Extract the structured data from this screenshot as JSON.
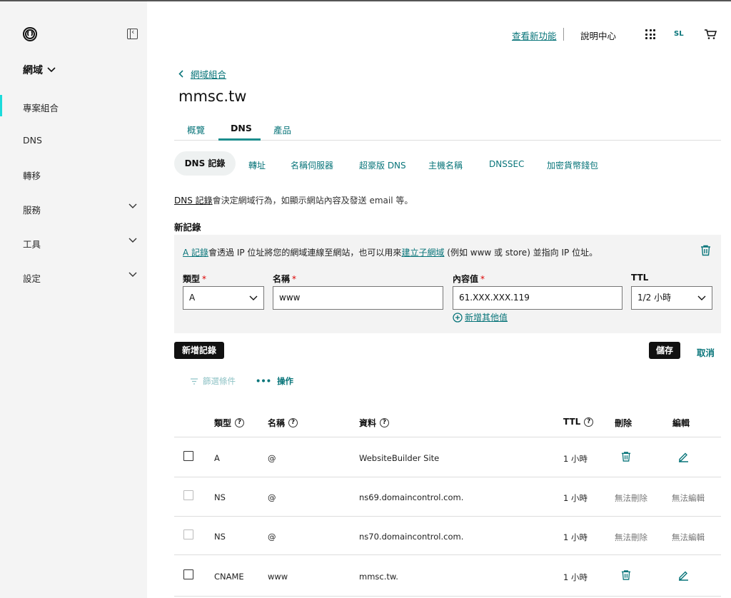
{
  "sidebar": {
    "domain_menu": "網域",
    "items": [
      {
        "label": "專案組合",
        "active": true,
        "has_chevron": false
      },
      {
        "label": "DNS",
        "active": false,
        "has_chevron": false
      },
      {
        "label": "轉移",
        "active": false,
        "has_chevron": false
      },
      {
        "label": "服務",
        "active": false,
        "has_chevron": true
      },
      {
        "label": "工具",
        "active": false,
        "has_chevron": true
      },
      {
        "label": "設定",
        "active": false,
        "has_chevron": true
      }
    ]
  },
  "topbar": {
    "whats_new": "查看新功能",
    "help": "說明中心",
    "avatar": "SL"
  },
  "breadcrumb": {
    "label": "網域組合"
  },
  "page_title": "mmsc.tw",
  "tabs": [
    "概覽",
    "DNS",
    "產品"
  ],
  "subtabs": [
    "DNS 記錄",
    "轉址",
    "名稱伺服器",
    "超豪版 DNS",
    "主機名稱",
    "DNSSEC",
    "加密貨幣錢包"
  ],
  "description": {
    "link": "DNS 記錄",
    "text": "會決定網域行為，如顯示網站內容及發送 email 等。"
  },
  "new_record": {
    "title": "新記錄",
    "info_link1": "A 記錄",
    "info_text1": "會透過 IP 位址將您的網域連線至網站，也可以用來",
    "info_link2": "建立子網域",
    "info_text2": " (例如 www 或 store) 並指向 IP 位址。",
    "fields": {
      "type_label": "類型",
      "type_value": "A",
      "name_label": "名稱",
      "name_value": "www",
      "value_label": "內容值",
      "value_value": "61.XXX.XXX.119",
      "ttl_label": "TTL",
      "ttl_value": "1/2 小時"
    },
    "add_value": "新增其他值"
  },
  "buttons": {
    "add_record": "新增記錄",
    "save": "儲存",
    "cancel": "取消"
  },
  "toolbar": {
    "filter": "篩選條件",
    "actions": "操作"
  },
  "table": {
    "headers": {
      "type": "類型",
      "name": "名稱",
      "data": "資料",
      "ttl": "TTL",
      "delete": "刪除",
      "edit": "編輯"
    },
    "rows": [
      {
        "type": "A",
        "name": "@",
        "data": "WebsiteBuilder Site",
        "ttl": "1 小時",
        "delete": "",
        "edit": "",
        "editable": true
      },
      {
        "type": "NS",
        "name": "@",
        "data": "ns69.domaincontrol.com.",
        "ttl": "1 小時",
        "delete": "無法刪除",
        "edit": "無法編輯",
        "editable": false
      },
      {
        "type": "NS",
        "name": "@",
        "data": "ns70.domaincontrol.com.",
        "ttl": "1 小時",
        "delete": "無法刪除",
        "edit": "無法編輯",
        "editable": false
      },
      {
        "type": "CNAME",
        "name": "www",
        "data": "mmsc.tw.",
        "ttl": "1 小時",
        "delete": "",
        "edit": "",
        "editable": true
      }
    ]
  },
  "colors": {
    "accent": "#09757a",
    "sidebar_bg": "#f4f4f4",
    "active_bar": "#1bdbdb"
  }
}
